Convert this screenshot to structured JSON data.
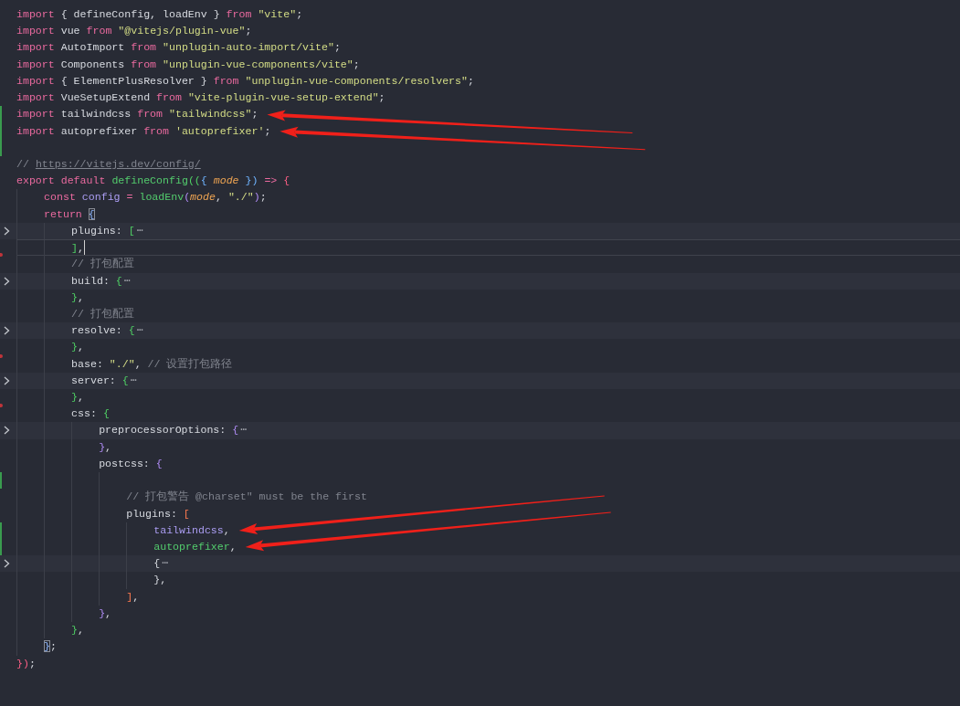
{
  "editor": {
    "lines": [
      {
        "folded": false,
        "cursor": false,
        "tokens": [
          {
            "text": "import",
            "kind": "keyword"
          },
          {
            "text": " { defineConfig, loadEnv } ",
            "kind": "plain"
          },
          {
            "text": "from",
            "kind": "keyword"
          },
          {
            "text": " \"vite\"",
            "kind": "string"
          },
          {
            "text": ";",
            "kind": "plain"
          }
        ]
      },
      {
        "folded": false,
        "cursor": false,
        "tokens": [
          {
            "text": "import",
            "kind": "keyword"
          },
          {
            "text": " vue ",
            "kind": "plain"
          },
          {
            "text": "from",
            "kind": "keyword"
          },
          {
            "text": " \"@vitejs/plugin-vue\"",
            "kind": "string"
          },
          {
            "text": ";",
            "kind": "plain"
          }
        ]
      },
      {
        "folded": false,
        "cursor": false,
        "tokens": [
          {
            "text": "import",
            "kind": "keyword"
          },
          {
            "text": " AutoImport ",
            "kind": "plain"
          },
          {
            "text": "from",
            "kind": "keyword"
          },
          {
            "text": " \"unplugin-auto-import/vite\"",
            "kind": "string"
          },
          {
            "text": ";",
            "kind": "plain"
          }
        ]
      },
      {
        "folded": false,
        "cursor": false,
        "tokens": [
          {
            "text": "import",
            "kind": "keyword"
          },
          {
            "text": " Components ",
            "kind": "plain"
          },
          {
            "text": "from",
            "kind": "keyword"
          },
          {
            "text": " \"unplugin-vue-components/vite\"",
            "kind": "string"
          },
          {
            "text": ";",
            "kind": "plain"
          }
        ]
      },
      {
        "folded": false,
        "cursor": false,
        "tokens": [
          {
            "text": "import",
            "kind": "keyword"
          },
          {
            "text": " { ElementPlusResolver } ",
            "kind": "plain"
          },
          {
            "text": "from",
            "kind": "keyword"
          },
          {
            "text": " \"unplugin-vue-components/resolvers\"",
            "kind": "string"
          },
          {
            "text": ";",
            "kind": "plain"
          }
        ]
      },
      {
        "folded": false,
        "cursor": false,
        "tokens": [
          {
            "text": "import",
            "kind": "keyword"
          },
          {
            "text": " VueSetupExtend ",
            "kind": "plain"
          },
          {
            "text": "from",
            "kind": "keyword"
          },
          {
            "text": " \"vite-plugin-vue-setup-extend\"",
            "kind": "string"
          },
          {
            "text": ";",
            "kind": "plain"
          }
        ]
      },
      {
        "folded": false,
        "cursor": false,
        "added": true,
        "annotated": true,
        "tokens": [
          {
            "text": "import",
            "kind": "keyword"
          },
          {
            "text": " tailwindcss ",
            "kind": "plain"
          },
          {
            "text": "from",
            "kind": "keyword"
          },
          {
            "text": " \"tailwindcss\"",
            "kind": "string"
          },
          {
            "text": ";",
            "kind": "plain"
          }
        ]
      },
      {
        "folded": false,
        "cursor": false,
        "added": true,
        "annotated": true,
        "tokens": [
          {
            "text": "import",
            "kind": "keyword"
          },
          {
            "text": " autoprefixer ",
            "kind": "plain"
          },
          {
            "text": "from",
            "kind": "keyword"
          },
          {
            "text": " 'autoprefixer'",
            "kind": "string"
          },
          {
            "text": ";",
            "kind": "plain"
          }
        ]
      },
      {
        "folded": false,
        "cursor": false,
        "added": true
      },
      {
        "folded": false,
        "cursor": false,
        "tokens": [
          {
            "text": "// ",
            "kind": "comment"
          },
          {
            "text": "https://vitejs.dev/config/",
            "kind": "link"
          }
        ]
      },
      {
        "folded": false,
        "cursor": false,
        "tokens": [
          {
            "text": "export",
            "kind": "keyword"
          },
          {
            "text": " default",
            "kind": "keyword"
          },
          {
            "text": " defineConfig",
            "kind": "function"
          },
          {
            "text": "((",
            "kind": "bracket1"
          },
          {
            "text": "{",
            "kind": "bracket3"
          },
          {
            "text": " mode",
            "kind": "param"
          },
          {
            "text": " })",
            "kind": "bracket3"
          },
          {
            "text": " =>",
            "kind": "keyword"
          },
          {
            "text": " {",
            "kind": "bracket4"
          }
        ],
        "children": [
          {
            "folded": false,
            "cursor": false,
            "tokens": [
              {
                "text": "const",
                "kind": "keyword"
              },
              {
                "text": " config",
                "kind": "variable"
              },
              {
                "text": " =",
                "kind": "keyword"
              },
              {
                "text": " loadEnv",
                "kind": "function"
              },
              {
                "text": "(",
                "kind": "bracket2"
              },
              {
                "text": "mode",
                "kind": "param"
              },
              {
                "text": ", ",
                "kind": "plain"
              },
              {
                "text": "\"./\"",
                "kind": "string"
              },
              {
                "text": ")",
                "kind": "bracket2"
              },
              {
                "text": ";",
                "kind": "plain"
              }
            ]
          },
          {
            "folded": false,
            "cursor": false,
            "tokens": [
              {
                "text": "return ",
                "kind": "keyword"
              },
              {
                "text": "{",
                "kind": "match"
              }
            ],
            "children": [
              {
                "folded": true,
                "cursor": false,
                "tokens": [
                  {
                    "text": "plugins: ",
                    "kind": "plain"
                  },
                  {
                    "text": "[",
                    "kind": "bracket1"
                  },
                  {
                    "text": "⋯",
                    "kind": "ellipsis"
                  }
                ]
              },
              {
                "folded": false,
                "cursor": true,
                "deleted": true,
                "tokens": [
                  {
                    "text": "]",
                    "kind": "bracket1"
                  },
                  {
                    "text": ",",
                    "kind": "plain"
                  }
                ]
              },
              {
                "folded": false,
                "cursor": false,
                "tokens": [
                  {
                    "text": "// 打包配置",
                    "kind": "comment"
                  }
                ]
              },
              {
                "folded": true,
                "cursor": false,
                "tokens": [
                  {
                    "text": "build: ",
                    "kind": "plain"
                  },
                  {
                    "text": "{",
                    "kind": "bracket1"
                  },
                  {
                    "text": "⋯",
                    "kind": "ellipsis"
                  }
                ]
              },
              {
                "folded": false,
                "cursor": false,
                "tokens": [
                  {
                    "text": "}",
                    "kind": "bracket1"
                  },
                  {
                    "text": ",",
                    "kind": "plain"
                  }
                ]
              },
              {
                "folded": false,
                "cursor": false,
                "tokens": [
                  {
                    "text": "// 打包配置",
                    "kind": "comment"
                  }
                ]
              },
              {
                "folded": true,
                "cursor": false,
                "tokens": [
                  {
                    "text": "resolve: ",
                    "kind": "plain"
                  },
                  {
                    "text": "{",
                    "kind": "bracket1"
                  },
                  {
                    "text": "⋯",
                    "kind": "ellipsis"
                  }
                ]
              },
              {
                "folded": false,
                "cursor": false,
                "deleted": true,
                "tokens": [
                  {
                    "text": "}",
                    "kind": "bracket1"
                  },
                  {
                    "text": ",",
                    "kind": "plain"
                  }
                ]
              },
              {
                "folded": false,
                "cursor": false,
                "tokens": [
                  {
                    "text": "base: ",
                    "kind": "plain"
                  },
                  {
                    "text": "\"./\"",
                    "kind": "string"
                  },
                  {
                    "text": ", ",
                    "kind": "plain"
                  },
                  {
                    "text": "// 设置打包路径",
                    "kind": "comment"
                  }
                ]
              },
              {
                "folded": true,
                "cursor": false,
                "tokens": [
                  {
                    "text": "server: ",
                    "kind": "plain"
                  },
                  {
                    "text": "{",
                    "kind": "bracket1"
                  },
                  {
                    "text": "⋯",
                    "kind": "ellipsis"
                  }
                ]
              },
              {
                "folded": false,
                "cursor": false,
                "deleted": true,
                "tokens": [
                  {
                    "text": "}",
                    "kind": "bracket1"
                  },
                  {
                    "text": ",",
                    "kind": "plain"
                  }
                ]
              },
              {
                "folded": false,
                "cursor": false,
                "tokens": [
                  {
                    "text": "css: ",
                    "kind": "plain"
                  },
                  {
                    "text": "{",
                    "kind": "bracket1"
                  }
                ],
                "children": [
                  {
                    "folded": true,
                    "cursor": false,
                    "tokens": [
                      {
                        "text": "preprocessorOptions: ",
                        "kind": "plain"
                      },
                      {
                        "text": "{",
                        "kind": "bracket2"
                      },
                      {
                        "text": "⋯",
                        "kind": "ellipsis"
                      }
                    ]
                  },
                  {
                    "folded": false,
                    "cursor": false,
                    "tokens": [
                      {
                        "text": "}",
                        "kind": "bracket2"
                      },
                      {
                        "text": ",",
                        "kind": "plain"
                      }
                    ]
                  },
                  {
                    "folded": false,
                    "cursor": false,
                    "tokens": [
                      {
                        "text": "postcss: ",
                        "kind": "plain"
                      },
                      {
                        "text": "{",
                        "kind": "bracket2"
                      }
                    ],
                    "children": [
                      {
                        "folded": false,
                        "cursor": false,
                        "added": true
                      },
                      {
                        "folded": false,
                        "cursor": false,
                        "tokens": [
                          {
                            "text": "// 打包警告 @charset\" must be the first",
                            "kind": "comment"
                          }
                        ]
                      },
                      {
                        "folded": false,
                        "cursor": false,
                        "tokens": [
                          {
                            "text": "plugins: ",
                            "kind": "plain"
                          },
                          {
                            "text": "[",
                            "kind": "bracket5"
                          }
                        ],
                        "children": [
                          {
                            "folded": false,
                            "cursor": false,
                            "added": true,
                            "annotated": true,
                            "tokens": [
                              {
                                "text": "tailwindcss",
                                "kind": "variable"
                              },
                              {
                                "text": ",",
                                "kind": "plain"
                              }
                            ]
                          },
                          {
                            "folded": false,
                            "cursor": false,
                            "added": true,
                            "annotated": true,
                            "tokens": [
                              {
                                "text": "autoprefixer",
                                "kind": "function"
                              },
                              {
                                "text": ",",
                                "kind": "plain"
                              }
                            ]
                          },
                          {
                            "folded": true,
                            "cursor": false,
                            "tokens": [
                              {
                                "text": "{",
                                "kind": "plain"
                              },
                              {
                                "text": "⋯",
                                "kind": "ellipsis"
                              }
                            ]
                          },
                          {
                            "folded": false,
                            "cursor": false,
                            "tokens": [
                              {
                                "text": "},",
                                "kind": "plain"
                              }
                            ]
                          }
                        ]
                      },
                      {
                        "folded": false,
                        "cursor": false,
                        "tokens": [
                          {
                            "text": "]",
                            "kind": "bracket5"
                          },
                          {
                            "text": ",",
                            "kind": "plain"
                          }
                        ]
                      }
                    ]
                  },
                  {
                    "folded": false,
                    "cursor": false,
                    "tokens": [
                      {
                        "text": "}",
                        "kind": "bracket2"
                      },
                      {
                        "text": ",",
                        "kind": "plain"
                      }
                    ]
                  }
                ]
              },
              {
                "folded": false,
                "cursor": false,
                "tokens": [
                  {
                    "text": "}",
                    "kind": "bracket1"
                  },
                  {
                    "text": ",",
                    "kind": "plain"
                  }
                ]
              }
            ]
          },
          {
            "folded": false,
            "cursor": false,
            "tokens": [
              {
                "text": "}",
                "kind": "match"
              },
              {
                "text": ";",
                "kind": "plain"
              }
            ]
          }
        ]
      },
      {
        "folded": false,
        "cursor": false,
        "tokens": [
          {
            "text": "})",
            "kind": "bracket4"
          },
          {
            "text": ";",
            "kind": "plain"
          }
        ]
      }
    ]
  }
}
